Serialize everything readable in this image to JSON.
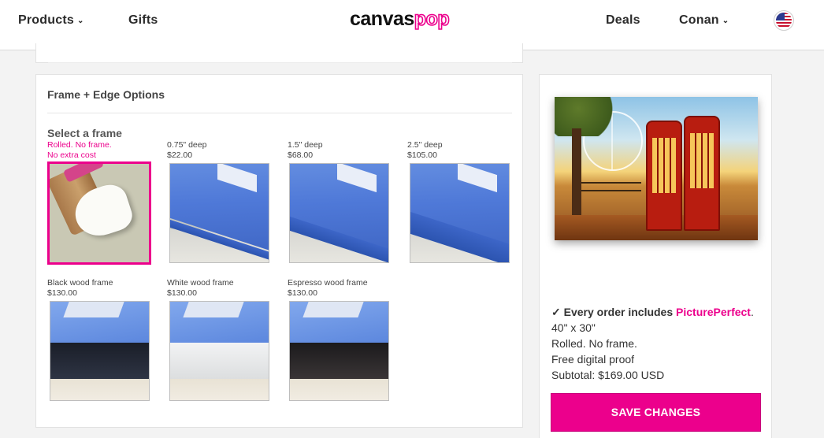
{
  "header": {
    "nav_products": "Products",
    "nav_gifts": "Gifts",
    "logo_part1": "canvas",
    "logo_part2": "pop",
    "nav_deals": "Deals",
    "nav_account": "Conan",
    "chevron": "⌄",
    "flag_icon": "us-flag-icon"
  },
  "options_card": {
    "title": "Frame + Edge Options",
    "select_label": "Select a frame",
    "frames": [
      {
        "name": "Rolled. No frame.",
        "price": "No extra cost",
        "icon": "rolled-canvas-thumbnail",
        "selected": true
      },
      {
        "name": "0.75\" deep",
        "price": "$22.00",
        "icon": "canvas-075-thumbnail",
        "selected": false
      },
      {
        "name": "1.5\" deep",
        "price": "$68.00",
        "icon": "canvas-15-thumbnail",
        "selected": false
      },
      {
        "name": "2.5\" deep",
        "price": "$105.00",
        "icon": "canvas-25-thumbnail",
        "selected": false
      },
      {
        "name": "Black wood frame",
        "price": "$130.00",
        "icon": "black-frame-thumbnail",
        "selected": false
      },
      {
        "name": "White wood frame",
        "price": "$130.00",
        "icon": "white-frame-thumbnail",
        "selected": false
      },
      {
        "name": "Espresso wood frame",
        "price": "$130.00",
        "icon": "espresso-frame-thumbnail",
        "selected": false
      }
    ]
  },
  "summary": {
    "check": "✓",
    "includes_text": "Every order includes ",
    "brand_text": "PicturePerfect",
    "period": ".",
    "size": "40\" x 30\"",
    "frame_choice": "Rolled. No frame.",
    "proof": "Free digital proof",
    "subtotal": "Subtotal: $169.00 USD",
    "save_label": "SAVE CHANGES"
  },
  "colors": {
    "accent": "#ec008c",
    "page_bg": "#f3f3f3",
    "card_bg": "#ffffff"
  }
}
